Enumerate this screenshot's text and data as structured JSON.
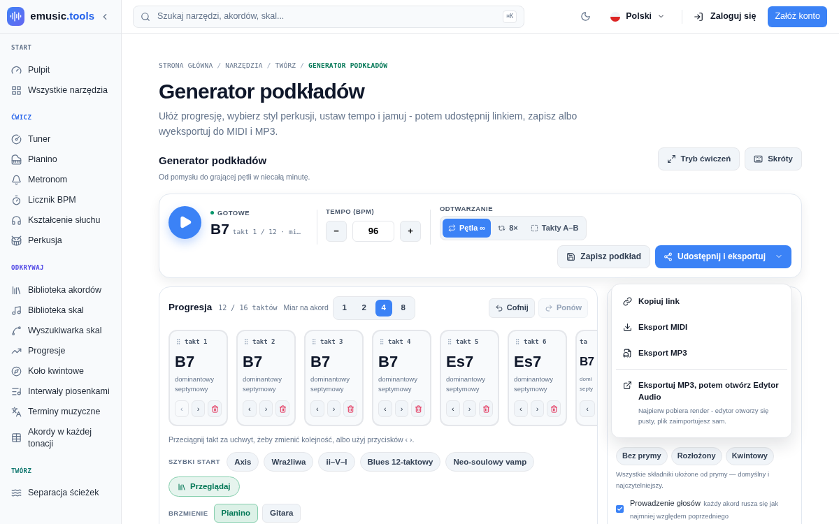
{
  "brand": {
    "name": "emusic",
    "suffix": ".tools"
  },
  "sidebar": {
    "sections": [
      {
        "title": "START",
        "color": "#64748b",
        "items": [
          "Pulpit",
          "Wszystkie narzędzia"
        ]
      },
      {
        "title": "ĆWICZ",
        "color": "#2563eb",
        "items": [
          "Tuner",
          "Pianino",
          "Metronom",
          "Licznik BPM",
          "Kształcenie słuchu",
          "Perkusja"
        ]
      },
      {
        "title": "ODKRYWAJ",
        "color": "#4f46e5",
        "items": [
          "Biblioteka akordów",
          "Biblioteka skal",
          "Wyszukiwarka skal",
          "Progresje",
          "Koło kwintowe",
          "Interwały piosenkami",
          "Terminy muzyczne",
          "Akordy w każdej tonacji"
        ]
      },
      {
        "title": "TWÓRZ",
        "color": "#0f766e",
        "items": [
          "Separacja ścieżek"
        ]
      }
    ]
  },
  "header": {
    "search": {
      "placeholder": "Szukaj narzędzi, akordów, skal...",
      "shortcut": "⌘K"
    },
    "language": "Polski",
    "login": "Zaloguj się",
    "signup": "Załóż konto"
  },
  "breadcrumb": [
    {
      "label": "STRONA GŁÓWNA",
      "current": false
    },
    {
      "label": "NARZĘDZIA",
      "current": false
    },
    {
      "label": "TWÓRZ",
      "current": false
    },
    {
      "label": "GENERATOR PODKŁADÓW",
      "current": true
    }
  ],
  "breadcrumb_separator": "/",
  "page": {
    "title": "Generator podkładów",
    "subtitle": "Ułóż progresję, wybierz styl perkusji, ustaw tempo i jamuj - potem udostępnij linkiem, zapisz albo wyeksportuj do MIDI i MP3."
  },
  "tool": {
    "title": "Generator podkładów",
    "subtitle": "Od pomysłu do grającej pętli w niecałą minutę.",
    "buttons": [
      "Tryb ćwiczeń",
      "Skróty"
    ]
  },
  "player": {
    "status": "GOTOWE",
    "chord": "B7",
    "position": "takt 1 / 12 · mi…",
    "tempo": {
      "label": "TEMPO (BPM)",
      "minus": "−",
      "value": "96",
      "plus": "+"
    },
    "playback": {
      "label": "ODTWARZANIE",
      "options": [
        {
          "label": "Pętla ∞",
          "selected": true
        },
        {
          "label": "8×",
          "selected": false
        },
        {
          "label": "Takty A–B",
          "selected": false
        }
      ]
    },
    "save": "Zapisz podkład",
    "share": "Udostępnij i eksportuj"
  },
  "progression": {
    "title": "Progresja",
    "count": "12 / 16 taktów",
    "per_chord_label": "Miar na akord",
    "per_chord": [
      {
        "label": "1",
        "selected": false
      },
      {
        "label": "2",
        "selected": false
      },
      {
        "label": "4",
        "selected": true
      },
      {
        "label": "8",
        "selected": false
      }
    ],
    "undo": {
      "label": "Cofnij",
      "disabled": false
    },
    "redo": {
      "label": "Ponów",
      "disabled": true
    },
    "bars": [
      {
        "label": "takt 1",
        "chord": "B7",
        "quality": "dominantowy septymowy",
        "prev": "‹",
        "next": "›",
        "prev_disabled": true
      },
      {
        "label": "takt 2",
        "chord": "B7",
        "quality": "dominantowy septymowy",
        "prev": "‹",
        "next": "›",
        "prev_disabled": false
      },
      {
        "label": "takt 3",
        "chord": "B7",
        "quality": "dominantowy septymowy",
        "prev": "‹",
        "next": "›",
        "prev_disabled": false
      },
      {
        "label": "takt 4",
        "chord": "B7",
        "quality": "dominantowy septymowy",
        "prev": "‹",
        "next": "›",
        "prev_disabled": false
      },
      {
        "label": "takt 5",
        "chord": "Es7",
        "quality": "dominantowy septymowy",
        "prev": "‹",
        "next": "›",
        "prev_disabled": false
      },
      {
        "label": "takt 6",
        "chord": "Es7",
        "quality": "dominantowy septymowy",
        "prev": "‹",
        "next": "›",
        "prev_disabled": false
      }
    ],
    "partial_bar": {
      "label": "ta",
      "chord": "B7",
      "quality_1": "domi",
      "quality_2": "septy",
      "prev": "‹"
    },
    "hint": "Przeciągnij takt za uchwyt, żeby zmienić kolejność, albo użyj przycisków ‹ ›.",
    "quick_start": {
      "label": "SZYBKI START",
      "chips": [
        {
          "label": "Axis",
          "kind": "preset"
        },
        {
          "label": "Wrażliwa",
          "kind": "preset"
        },
        {
          "label": "ii–V–I",
          "kind": "preset"
        },
        {
          "label": "Blues 12-taktowy",
          "kind": "preset"
        },
        {
          "label": "Neo-soulowy vamp",
          "kind": "preset"
        },
        {
          "label": "Przeglądaj",
          "kind": "browse"
        }
      ]
    },
    "sound": {
      "label": "BRZMIENIE",
      "options": [
        {
          "label": "Pianino",
          "selected": true
        },
        {
          "label": "Gitara",
          "selected": false
        }
      ]
    }
  },
  "voicing": {
    "options": [
      {
        "label": "Bez prymy",
        "selected": false
      },
      {
        "label": "Rozłożony",
        "selected": false
      },
      {
        "label": "Kwintowy",
        "selected": false
      }
    ],
    "description": "Wszystkie składniki ułożone od prymy — domyślny i najczytelniejszy.",
    "voice_leading": {
      "label": "Prowadzenie głosów",
      "hint": "każdy akord rusza się jak najmniej względem poprzedniego",
      "checked": true
    }
  },
  "share_menu": [
    {
      "kind": "link",
      "label": "Kopiuj link"
    },
    {
      "kind": "midi",
      "label": "Eksport MIDI"
    },
    {
      "kind": "mp3",
      "label": "Eksport MP3"
    },
    {
      "kind": "editor",
      "label": "Eksportuj MP3, potem otwórz Edytor Audio",
      "description": "Najpierw pobiera render - edytor otworzy się pusty, plik zaimportujesz sam."
    }
  ]
}
